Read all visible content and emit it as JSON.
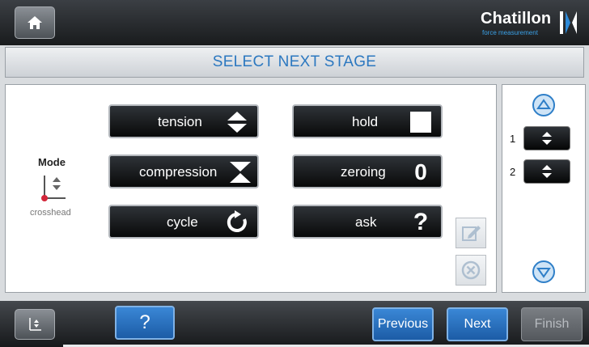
{
  "header": {
    "home_icon": "home-icon",
    "brand": {
      "name": "Chatillon",
      "tagline": "force measurement"
    }
  },
  "title": "SELECT NEXT STAGE",
  "mode": {
    "label": "Mode",
    "value": "crosshead",
    "icon": "crosshead-icon"
  },
  "stages": [
    {
      "label": "tension",
      "icon": "up-down-arrows-icon"
    },
    {
      "label": "hold",
      "icon": "stop-square-icon"
    },
    {
      "label": "compression",
      "icon": "converging-arrows-icon"
    },
    {
      "label": "zeroing",
      "icon": "zero-icon",
      "icon_text": "0"
    },
    {
      "label": "cycle",
      "icon": "cycle-icon"
    },
    {
      "label": "ask",
      "icon": "question-icon",
      "icon_text": "?"
    }
  ],
  "side_actions": {
    "edit_icon": "edit-icon",
    "delete_icon": "delete-icon"
  },
  "sequence": {
    "items": [
      {
        "number": "1",
        "icon": "up-down-arrows-icon"
      },
      {
        "number": "2",
        "icon": "up-down-arrows-icon"
      }
    ],
    "scroll_up_icon": "scroll-up-icon",
    "scroll_down_icon": "scroll-down-icon"
  },
  "footer": {
    "mode_icon": "mode-icon",
    "help_label": "?",
    "previous_label": "Previous",
    "next_label": "Next",
    "finish_label": "Finish"
  },
  "colors": {
    "accent": "#2c78c0",
    "button_blue": "#1f63b0",
    "dark_button": "#0b0c0d"
  }
}
